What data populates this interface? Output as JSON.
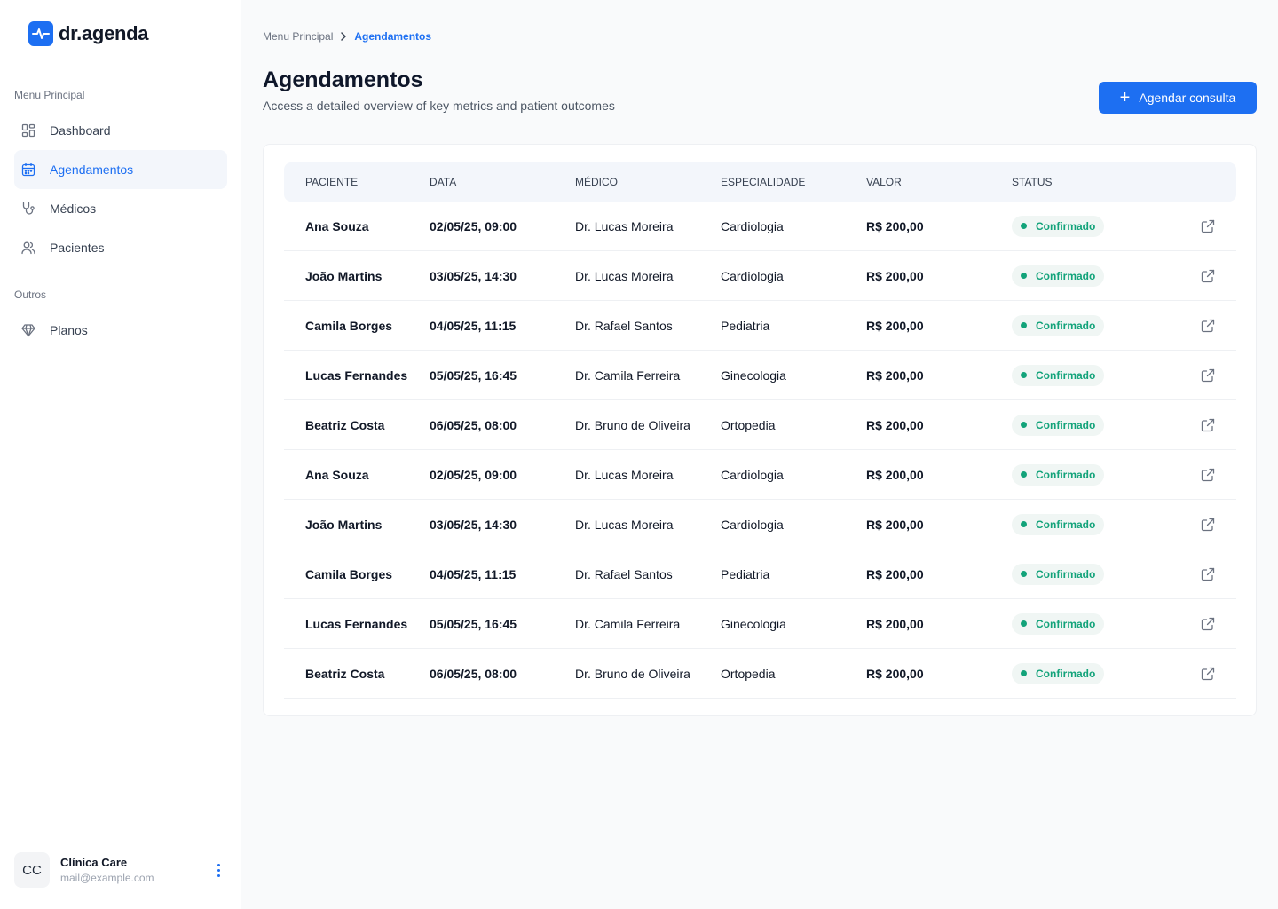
{
  "brand": {
    "name": "dr.agenda",
    "accent": "#1d6ff2"
  },
  "sidebar": {
    "section_main": "Menu Principal",
    "items_main": [
      {
        "label": "Dashboard",
        "icon": "grid-icon",
        "active": false
      },
      {
        "label": "Agendamentos",
        "icon": "calendar-icon",
        "active": true
      },
      {
        "label": "Médicos",
        "icon": "stethoscope-icon",
        "active": false
      },
      {
        "label": "Pacientes",
        "icon": "users-icon",
        "active": false
      }
    ],
    "section_other": "Outros",
    "items_other": [
      {
        "label": "Planos",
        "icon": "diamond-icon",
        "active": false
      }
    ]
  },
  "user": {
    "initials": "CC",
    "name": "Clínica Care",
    "email": "mail@example.com"
  },
  "breadcrumb": {
    "root": "Menu Principal",
    "current": "Agendamentos"
  },
  "page": {
    "title": "Agendamentos",
    "subtitle": "Access a detailed overview of key metrics and patient outcomes",
    "action_label": "Agendar consulta"
  },
  "table": {
    "columns": [
      "PACIENTE",
      "DATA",
      "MÉDICO",
      "ESPECIALIDADE",
      "VALOR",
      "STATUS"
    ],
    "rows": [
      {
        "paciente": "Ana Souza",
        "data": "02/05/25, 09:00",
        "medico": "Dr.  Lucas Moreira",
        "especialidade": "Cardiologia",
        "valor": "R$ 200,00",
        "status": "Confirmado"
      },
      {
        "paciente": "João Martins",
        "data": "03/05/25, 14:30",
        "medico": "Dr.  Lucas Moreira",
        "especialidade": "Cardiologia",
        "valor": "R$ 200,00",
        "status": "Confirmado"
      },
      {
        "paciente": "Camila Borges",
        "data": "04/05/25, 11:15",
        "medico": "Dr. Rafael Santos",
        "especialidade": "Pediatria",
        "valor": "R$ 200,00",
        "status": "Confirmado"
      },
      {
        "paciente": "Lucas Fernandes",
        "data": "05/05/25, 16:45",
        "medico": "Dr. Camila Ferreira",
        "especialidade": "Ginecologia",
        "valor": "R$ 200,00",
        "status": "Confirmado"
      },
      {
        "paciente": "Beatriz Costa",
        "data": "06/05/25, 08:00",
        "medico": "Dr. Bruno de Oliveira",
        "especialidade": "Ortopedia",
        "valor": "R$ 200,00",
        "status": "Confirmado"
      },
      {
        "paciente": "Ana Souza",
        "data": "02/05/25, 09:00",
        "medico": "Dr.  Lucas Moreira",
        "especialidade": "Cardiologia",
        "valor": "R$ 200,00",
        "status": "Confirmado"
      },
      {
        "paciente": "João Martins",
        "data": "03/05/25, 14:30",
        "medico": "Dr.  Lucas Moreira",
        "especialidade": "Cardiologia",
        "valor": "R$ 200,00",
        "status": "Confirmado"
      },
      {
        "paciente": "Camila Borges",
        "data": "04/05/25, 11:15",
        "medico": "Dr. Rafael Santos",
        "especialidade": "Pediatria",
        "valor": "R$ 200,00",
        "status": "Confirmado"
      },
      {
        "paciente": "Lucas Fernandes",
        "data": "05/05/25, 16:45",
        "medico": "Dr. Camila Ferreira",
        "especialidade": "Ginecologia",
        "valor": "R$ 200,00",
        "status": "Confirmado"
      },
      {
        "paciente": "Beatriz Costa",
        "data": "06/05/25, 08:00",
        "medico": "Dr. Bruno de Oliveira",
        "especialidade": "Ortopedia",
        "valor": "R$ 200,00",
        "status": "Confirmado"
      }
    ]
  },
  "colors": {
    "status_confirmed": "#12a37a",
    "status_bg": "#f0f6f4"
  }
}
